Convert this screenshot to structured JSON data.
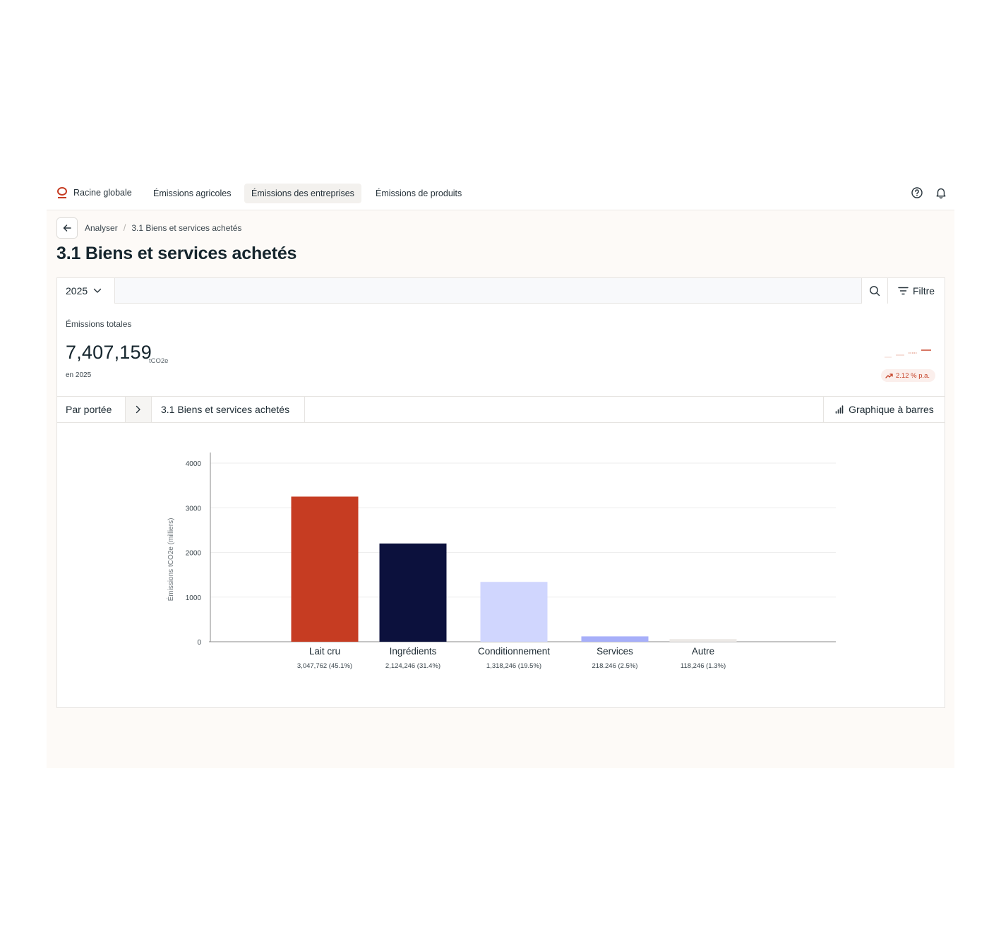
{
  "nav": {
    "brand": "Racine globale",
    "links": [
      {
        "label": "Émissions agricoles"
      },
      {
        "label": "Émissions des entreprises"
      },
      {
        "label": "Émissions de produits"
      }
    ],
    "active_index": 1,
    "icons": [
      "help-icon",
      "bell-icon"
    ]
  },
  "breadcrumb": {
    "items": [
      "Analyser",
      "3.1 Biens et services achetés"
    ],
    "separator": "/"
  },
  "page": {
    "title": "3.1 Biens et services achetés"
  },
  "toolbar": {
    "year": "2025",
    "filter_label": "Filtre"
  },
  "stats": {
    "label": "Émissions totales",
    "value": "7,407,159",
    "unit": "tCO2e",
    "year_caption": "en 2025",
    "trend": "2.12 % p.a.",
    "trend_color": "#c43d22"
  },
  "scope": {
    "group_label": "Par portée",
    "current": "3.1 Biens et services achetés",
    "chart_type_label": "Graphique à barres"
  },
  "chart_data": {
    "type": "bar",
    "ylabel": "Émissions tCO2e (milliers)",
    "ylim": [
      0,
      4000
    ],
    "yticks": [
      0,
      1000,
      2000,
      3000,
      4000
    ],
    "grid": true,
    "categories": [
      "Lait cru",
      "Ingrédients",
      "Conditionnement",
      "Services",
      "Autre"
    ],
    "values": [
      3250,
      2200,
      1340,
      120,
      60
    ],
    "value_labels": [
      "3,047,762 (45.1%)",
      "2,124,246 (31.4%)",
      "1,318,246 (19.5%)",
      "218.246 (2.5%)",
      "118,246 (1.3%)"
    ],
    "colors": [
      "#c63c22",
      "#0c113d",
      "#d0d6fe",
      "#a7aff9",
      "#ece9e6"
    ]
  }
}
